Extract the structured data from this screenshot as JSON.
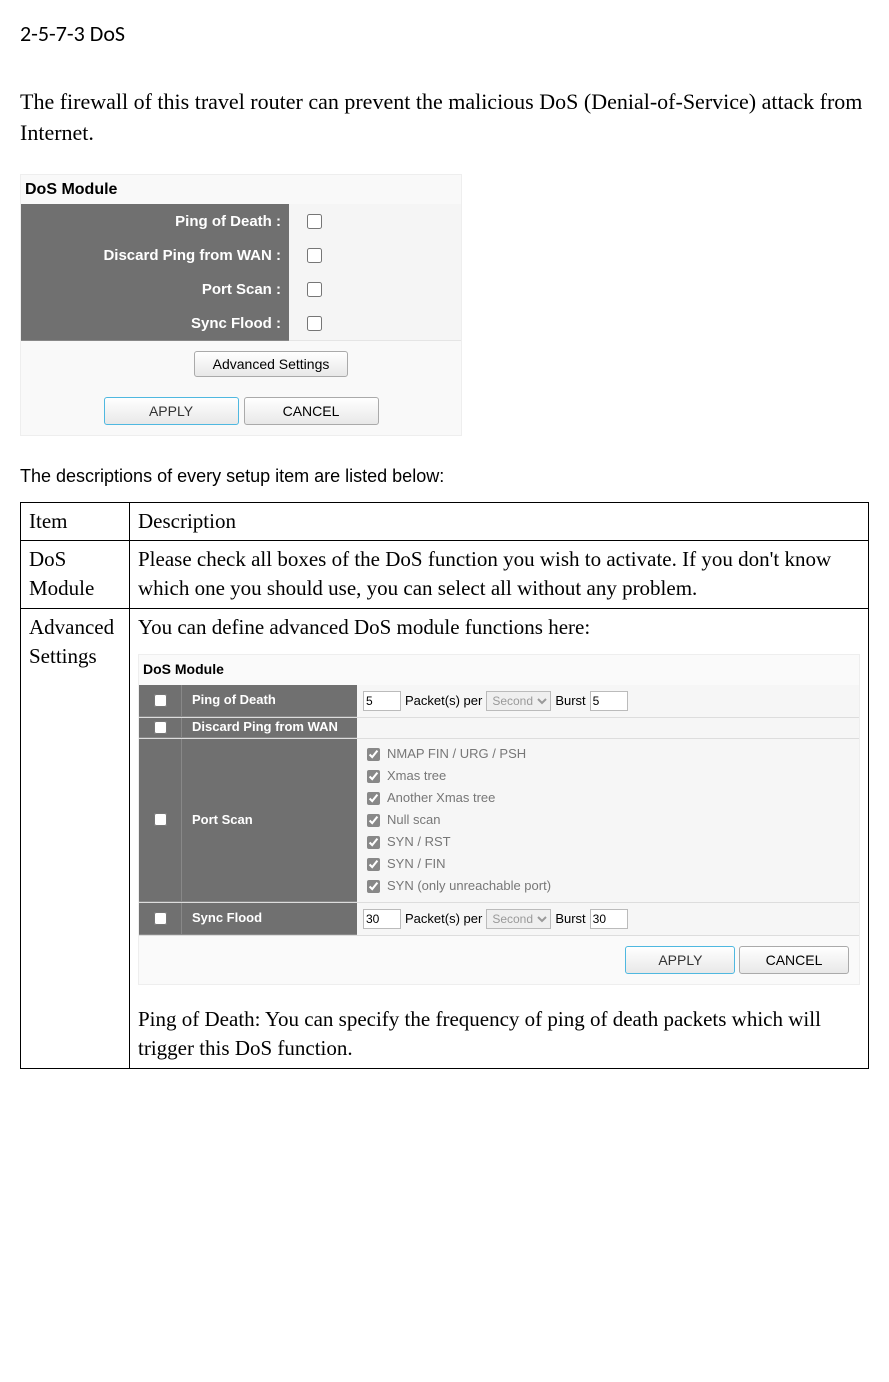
{
  "heading": "2-5-7-3 DoS",
  "intro": "The firewall of this travel router can prevent the malicious DoS (Denial-of-Service) attack from Internet.",
  "dos": {
    "title": "DoS Module",
    "rows": {
      "ping": "Ping of Death :",
      "discard": "Discard Ping from WAN :",
      "portscan": "Port Scan :",
      "sync": "Sync Flood :"
    },
    "adv_btn": "Advanced Settings",
    "apply": "APPLY",
    "cancel": "CANCEL"
  },
  "desc_intro": "The descriptions of every setup item are listed below:",
  "table": {
    "h1": "Item",
    "h2": "Description",
    "r1c1": "DoS Module",
    "r1c2": "Please check all boxes of the DoS function you wish to activate. If you don't know which one you should use, you can select all without any problem.",
    "r2c1": "Advanced Settings",
    "r2c2a": "You can define advanced DoS module functions here:",
    "r2c2b": "Ping of Death: You can specify the frequency of ping of death packets which will trigger this DoS function."
  },
  "adv": {
    "title": "DoS Module",
    "ping": "Ping of Death",
    "discard": "Discard Ping from WAN",
    "portscan": "Port Scan",
    "sync": "Sync Flood",
    "packets": "Packet(s) per",
    "second": "Second",
    "burst": "Burst",
    "v5": "5",
    "v30": "30",
    "scan": {
      "a": "NMAP FIN / URG / PSH",
      "b": "Xmas tree",
      "c": "Another Xmas tree",
      "d": "Null scan",
      "e": "SYN / RST",
      "f": "SYN / FIN",
      "g": "SYN (only unreachable port)"
    },
    "apply": "APPLY",
    "cancel": "CANCEL"
  }
}
